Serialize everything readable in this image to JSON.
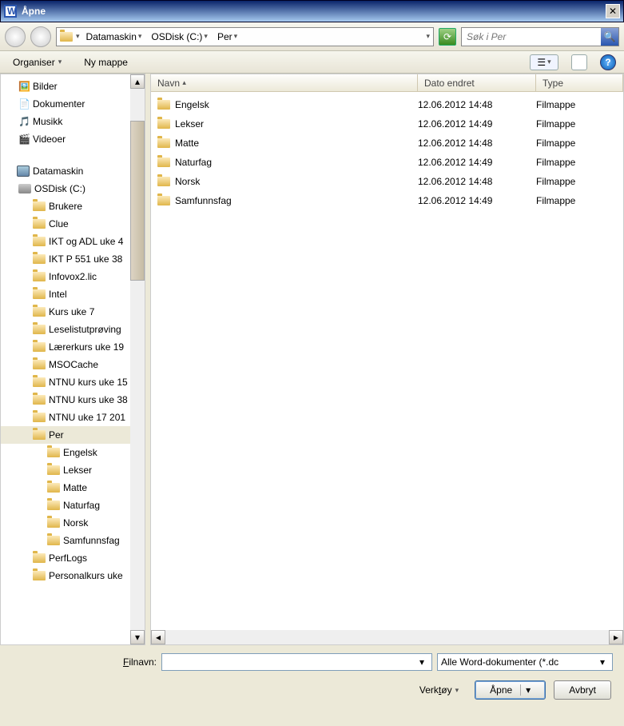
{
  "titlebar": {
    "title": "Åpne",
    "close": "✕"
  },
  "nav": {
    "crumbs": [
      "Datamaskin",
      "OSDisk (C:)",
      "Per"
    ],
    "refresh": "⟳",
    "search_placeholder": "Søk i Per",
    "search_icon": "🔍"
  },
  "toolbar": {
    "organize": "Organiser",
    "newfolder": "Ny mappe",
    "help": "?"
  },
  "tree": {
    "libraries": [
      {
        "label": "Bilder"
      },
      {
        "label": "Dokumenter"
      },
      {
        "label": "Musikk"
      },
      {
        "label": "Videoer"
      }
    ],
    "computer": "Datamaskin",
    "disk": "OSDisk (C:)",
    "folders": [
      "Brukere",
      "Clue",
      "IKT og ADL uke 4",
      "IKT P 551 uke 38",
      "Infovox2.lic",
      "Intel",
      "Kurs uke 7",
      "Leselistutprøving",
      "Lærerkurs uke 19",
      "MSOCache",
      "NTNU kurs uke 15",
      "NTNU kurs uke 38",
      "NTNU uke 17 201"
    ],
    "selected": "Per",
    "subfolders": [
      "Engelsk",
      "Lekser",
      "Matte",
      "Naturfag",
      "Norsk",
      "Samfunnsfag"
    ],
    "after": [
      "PerfLogs",
      "Personalkurs uke"
    ]
  },
  "list": {
    "headers": {
      "name": "Navn",
      "date": "Dato endret",
      "type": "Type"
    },
    "sort_arrow": "▴",
    "rows": [
      {
        "name": "Engelsk",
        "date": "12.06.2012 14:48",
        "type": "Filmappe"
      },
      {
        "name": "Lekser",
        "date": "12.06.2012 14:49",
        "type": "Filmappe"
      },
      {
        "name": "Matte",
        "date": "12.06.2012 14:48",
        "type": "Filmappe"
      },
      {
        "name": "Naturfag",
        "date": "12.06.2012 14:49",
        "type": "Filmappe"
      },
      {
        "name": "Norsk",
        "date": "12.06.2012 14:48",
        "type": "Filmappe"
      },
      {
        "name": "Samfunnsfag",
        "date": "12.06.2012 14:49",
        "type": "Filmappe"
      }
    ]
  },
  "bottom": {
    "filename_label": "Filnavn:",
    "filetype": "Alle Word-dokumenter (*.dc",
    "tools": "Verktøy",
    "open": "Åpne",
    "cancel": "Avbryt"
  }
}
